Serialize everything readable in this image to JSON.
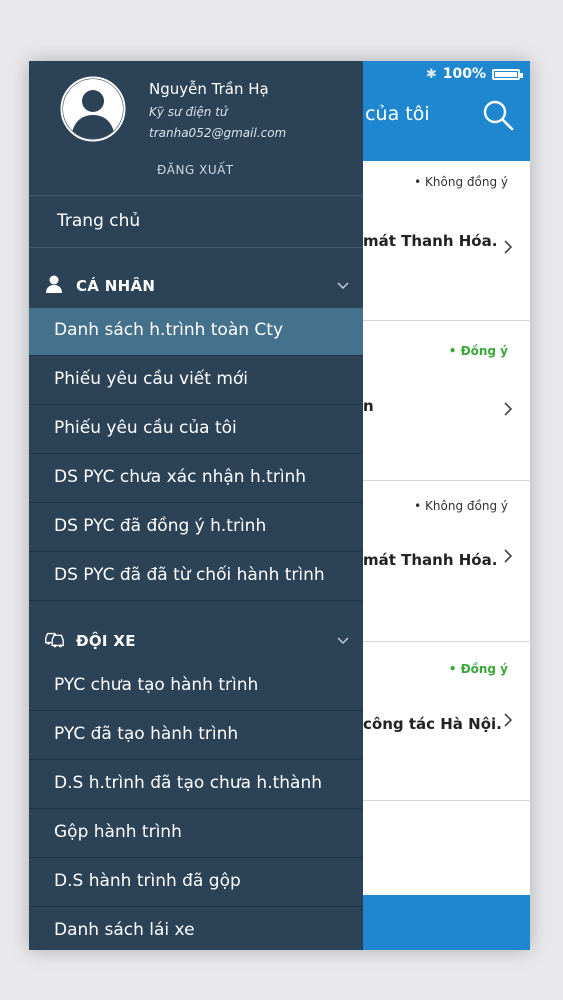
{
  "status_bar": {
    "battery": "100%"
  },
  "app_bar": {
    "title": "u của tôi"
  },
  "cards": [
    {
      "status": "Không đồng ý",
      "status_type": "reject",
      "text": "mát Thanh Hóa."
    },
    {
      "status": "Đồng ý",
      "status_type": "accept",
      "text": "n"
    },
    {
      "status": "Không đồng ý",
      "status_type": "reject",
      "text": "mát Thanh Hóa."
    },
    {
      "status": "Đồng ý",
      "status_type": "accept",
      "text": "công tác Hà Nội."
    }
  ],
  "drawer": {
    "profile": {
      "name": "Nguyễn Trần Hạ",
      "role": "Kỹ sư điện tử",
      "email": "tranha052@gmail.com",
      "logout": "ĐĂNG XUẤT"
    },
    "home": "Trang chủ",
    "sections": [
      {
        "label": "CÁ NHÂN",
        "icon": "person-icon",
        "items": [
          "Danh sách h.trình toàn Cty",
          "Phiếu yêu cầu viết mới",
          "Phiếu yêu cầu của tôi",
          "DS PYC chưa xác nhận h.trình",
          "DS PYC đã đồng ý h.trình",
          "DS PYC đã đã từ chối hành trình"
        ]
      },
      {
        "label": "ĐỘI XE",
        "icon": "cars-icon",
        "items": [
          "PYC chưa tạo hành trình",
          "PYC đã tạo hành trình",
          "D.S h.trình đã tạo chưa h.thành",
          "Gộp hành trình",
          "D.S hành trình đã gộp",
          "Danh sách lái xe"
        ]
      }
    ]
  },
  "colors": {
    "drawer_bg": "#2b4257",
    "active_item": "#44718b",
    "app_bar": "#1e87d0",
    "accept_status": "#3aa83a"
  }
}
